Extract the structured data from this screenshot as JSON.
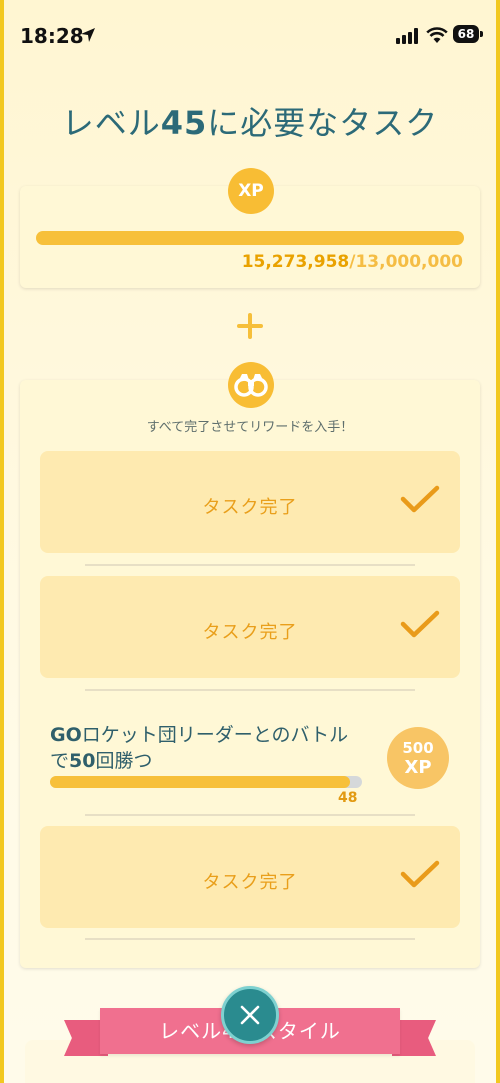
{
  "status_bar": {
    "time": "18:28",
    "battery": "68",
    "icons": [
      "location-arrow-icon",
      "cellular-signal-icon",
      "wifi-icon",
      "battery-icon"
    ]
  },
  "title": {
    "prefix": "レベル",
    "level": "45",
    "suffix": "に必要なタスク"
  },
  "xp": {
    "badge": "XP",
    "current": "15,273,958",
    "separator": "/",
    "goal": "13,000,000",
    "progress": 1.0
  },
  "tasks_section": {
    "subtitle": "すべて完了させてリワードを入手！",
    "items": [
      {
        "label": "タスク完了",
        "done": true
      },
      {
        "label": "タスク完了",
        "done": true
      },
      {
        "text_part1": "GO",
        "text_part2": "ロケット団リーダーとのバトル",
        "text_part3": "で",
        "text_part4": "50",
        "text_part5": "回勝つ",
        "progress_value": "48",
        "progress_fraction": 0.96,
        "reward_amount": "500",
        "reward_unit": "XP"
      },
      {
        "label": "タスク完了",
        "done": true
      }
    ]
  },
  "ribbon": {
    "text": "レベル45 スタイル"
  },
  "colors": {
    "accent_yellow": "#f7c03a",
    "title_teal": "#2c6a78",
    "done_orange": "#e99f1b",
    "ribbon_pink": "#f0708f",
    "close_teal": "#2a8b8f"
  }
}
